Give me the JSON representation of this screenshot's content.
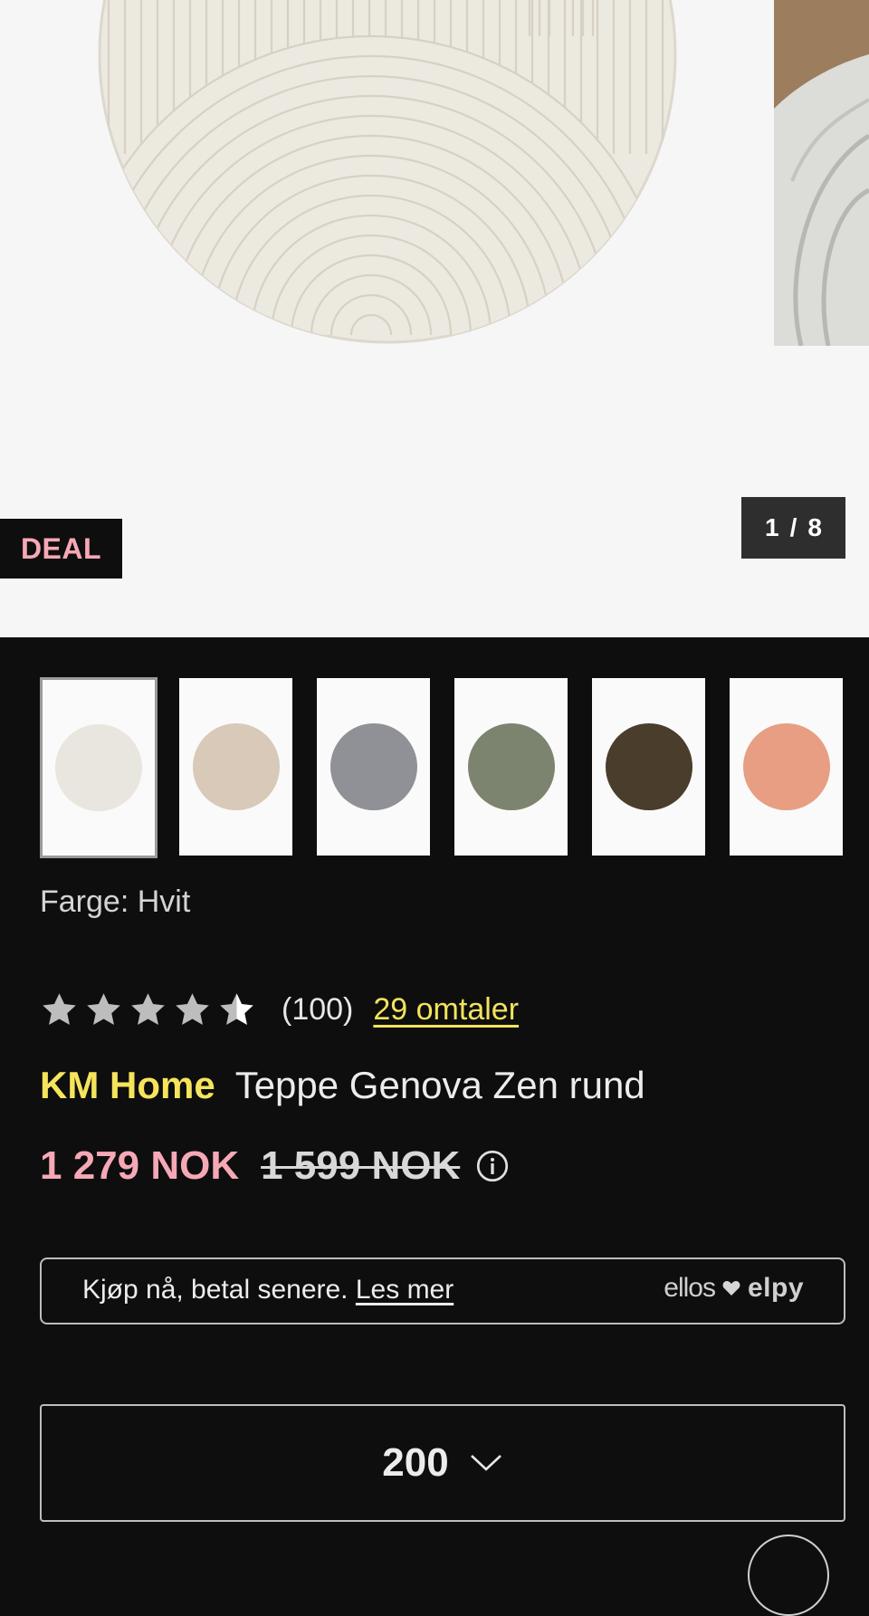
{
  "gallery": {
    "badge": "DEAL",
    "counter_current": "1",
    "counter_sep": "/",
    "counter_total": "8"
  },
  "thumbnails": [
    {
      "color": "#e9e6df",
      "selected": true
    },
    {
      "color": "#d8c9b8",
      "selected": false
    },
    {
      "color": "#8f9196",
      "selected": false
    },
    {
      "color": "#7c8470",
      "selected": false
    },
    {
      "color": "#4a3d2c",
      "selected": false
    },
    {
      "color": "#e89e82",
      "selected": false
    }
  ],
  "product": {
    "color_label": "Farge: Hvit",
    "rating_value": 4.5,
    "rating_count": "(100)",
    "reviews_link": "29 omtaler",
    "brand": "KM Home",
    "name": "Teppe Genova Zen rund",
    "price": "1 279 NOK",
    "old_price": "1 599 NOK"
  },
  "bnpl": {
    "text": "Kjøp nå, betal senere.",
    "link": "Les mer",
    "brand_left": "ellos",
    "brand_right": "elpy"
  },
  "size_select": {
    "value": "200"
  },
  "colors": {
    "accent_yellow": "#f5e45c",
    "sale_pink": "#f6a8b6",
    "background": "#0e0e0e"
  }
}
